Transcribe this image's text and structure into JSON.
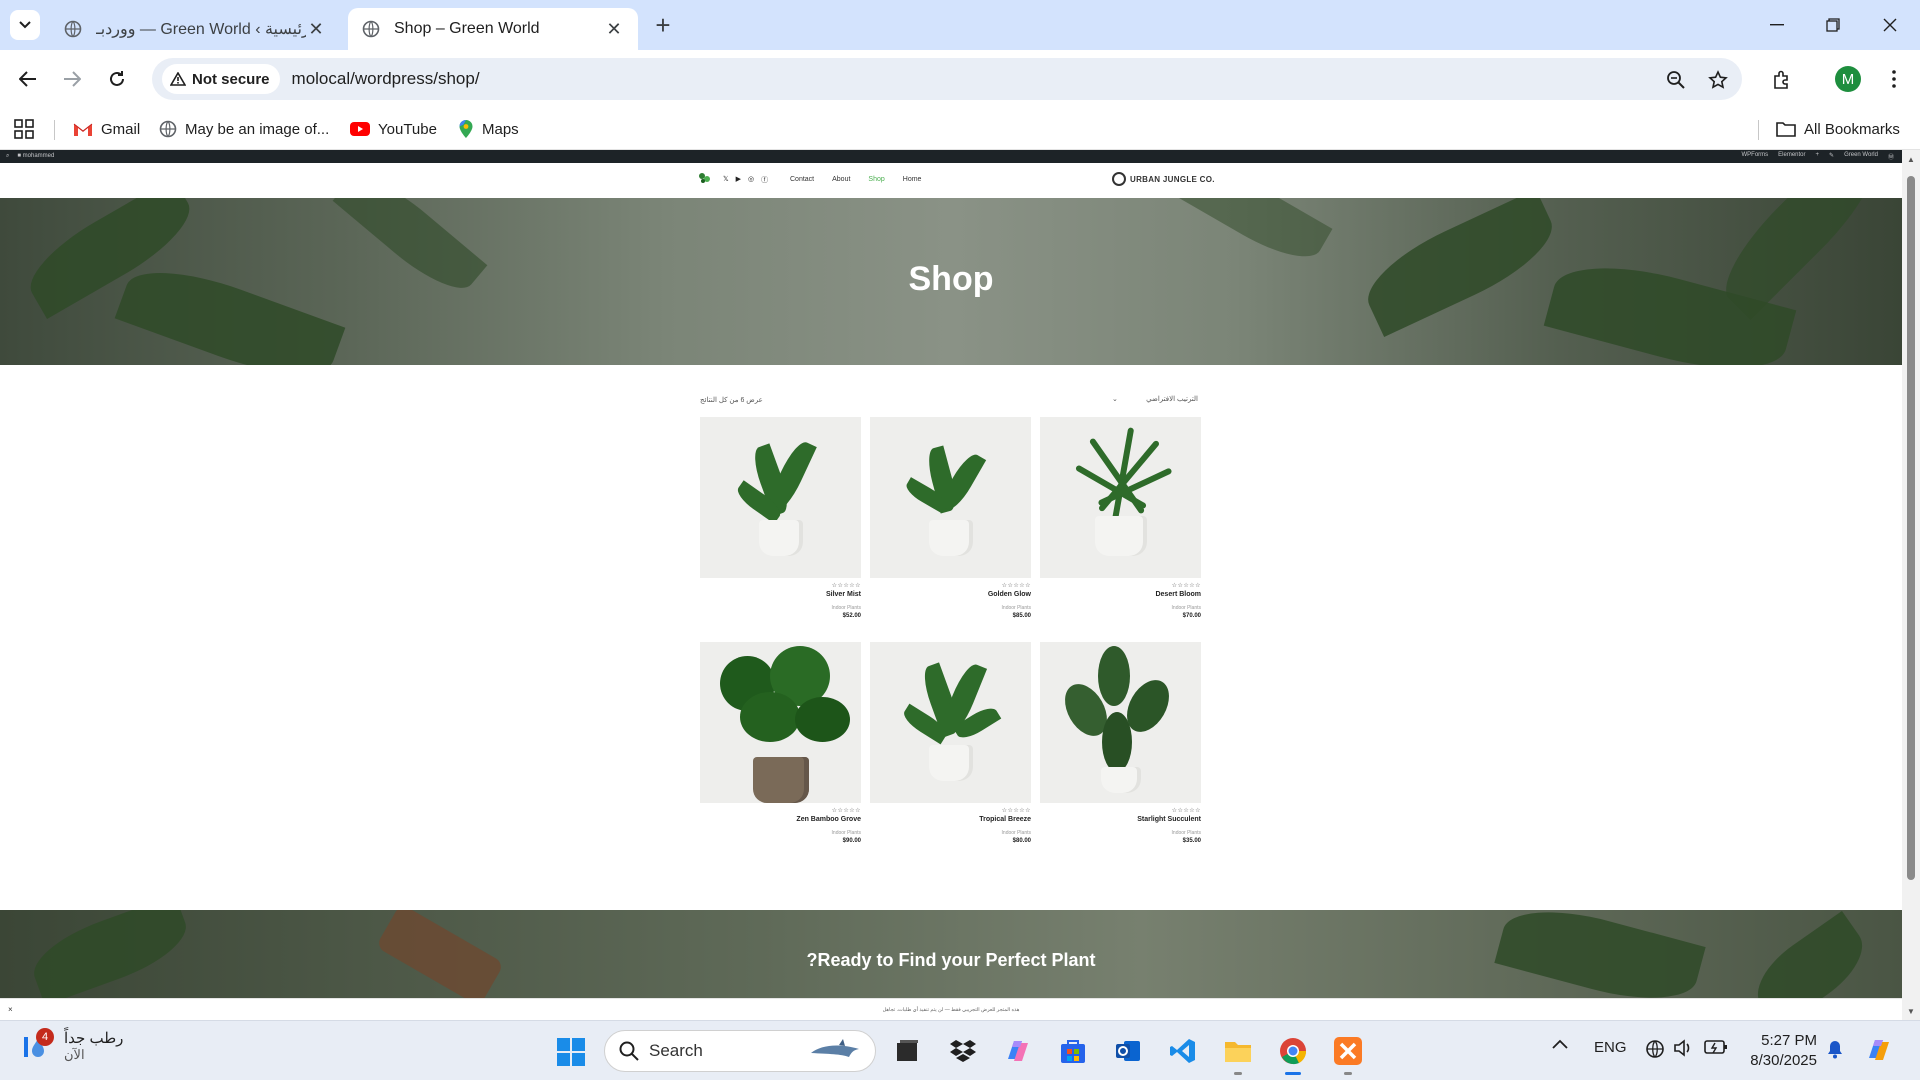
{
  "browser": {
    "tabs": [
      {
        "title": "ووردبـ — Green World ‹ الرئيسية",
        "active": false
      },
      {
        "title": "Shop – Green World",
        "active": true
      }
    ],
    "security_label": "Not secure",
    "url": "molocal/wordpress/shop/",
    "profile_initial": "M",
    "bookmarks": [
      {
        "label": "Gmail",
        "icon": "gmail-icon"
      },
      {
        "label": "May be an image of...",
        "icon": "globe-icon"
      },
      {
        "label": "YouTube",
        "icon": "youtube-icon"
      },
      {
        "label": "Maps",
        "icon": "maps-icon"
      }
    ],
    "all_bookmarks": "All Bookmarks"
  },
  "site": {
    "nav": [
      "Contact",
      "About",
      "Shop",
      "Home"
    ],
    "active_nav": "Shop",
    "logo_text": "URBAN JUNGLE CO.",
    "hero_title": "Shop",
    "result_count": "عرض 6 من كل النتائج",
    "ordering": "الترتيب الافتراضي",
    "products": [
      {
        "name": "Silver Mist",
        "category": "Indoor Plants",
        "price": "$52.00",
        "stars": "☆☆☆☆☆"
      },
      {
        "name": "Golden Glow",
        "category": "Indoor Plants",
        "price": "$85.00",
        "stars": "☆☆☆☆☆"
      },
      {
        "name": "Desert Bloom",
        "category": "Indoor Plants",
        "price": "$70.00",
        "stars": "☆☆☆☆☆"
      },
      {
        "name": "Zen Bamboo Grove",
        "category": "Indoor Plants",
        "price": "$90.00",
        "stars": "☆☆☆☆☆"
      },
      {
        "name": "Tropical Breeze",
        "category": "Indoor Plants",
        "price": "$80.00",
        "stars": "☆☆☆☆☆"
      },
      {
        "name": "Starlight Succulent",
        "category": "Indoor Plants",
        "price": "$35.00",
        "stars": "☆☆☆☆☆"
      }
    ],
    "cta_title": "?Ready to Find your Perfect Plant",
    "notice": "هذه المتجر للعرض التجريبي فقط — لن يتم تنفيذ أي طلبات. تجاهل"
  },
  "taskbar": {
    "weather_line1": "رطب جداً",
    "weather_line2": "الآن",
    "weather_badge": "4",
    "search_placeholder": "Search",
    "lang": "ENG",
    "time": "5:27 PM",
    "date": "8/30/2025"
  },
  "colors": {
    "accent_green": "#4caf50",
    "tab_strip": "#d3e3fd",
    "taskbar": "#e8edf5"
  }
}
